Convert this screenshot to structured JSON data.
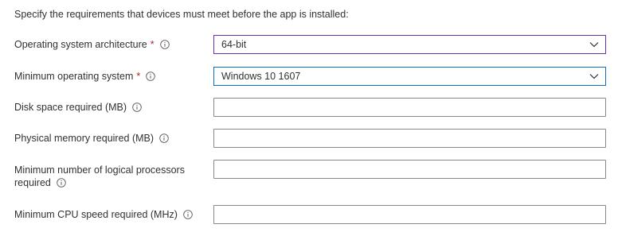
{
  "intro": "Specify the requirements that devices must meet before the app is installed:",
  "fields": {
    "os_arch": {
      "label": "Operating system architecture",
      "required_mark": "*",
      "value": "64-bit"
    },
    "min_os": {
      "label": "Minimum operating system",
      "required_mark": "*",
      "value": "Windows 10 1607"
    },
    "disk_space": {
      "label": "Disk space required (MB)",
      "value": ""
    },
    "physical_memory": {
      "label": "Physical memory required (MB)",
      "value": ""
    },
    "logical_processors": {
      "label_line1": "Minimum number of logical processors",
      "label_line2": "required",
      "value": ""
    },
    "cpu_speed": {
      "label": "Minimum CPU speed required (MHz)",
      "value": ""
    }
  },
  "icons": {
    "info": "info-circle-icon",
    "dropdown": "chevron-down-icon"
  },
  "colors": {
    "required": "#a4262c",
    "selected_border": "#6b2fa8",
    "focus_border": "#0f6cbd",
    "input_border": "#8a8886",
    "text": "#323130"
  }
}
